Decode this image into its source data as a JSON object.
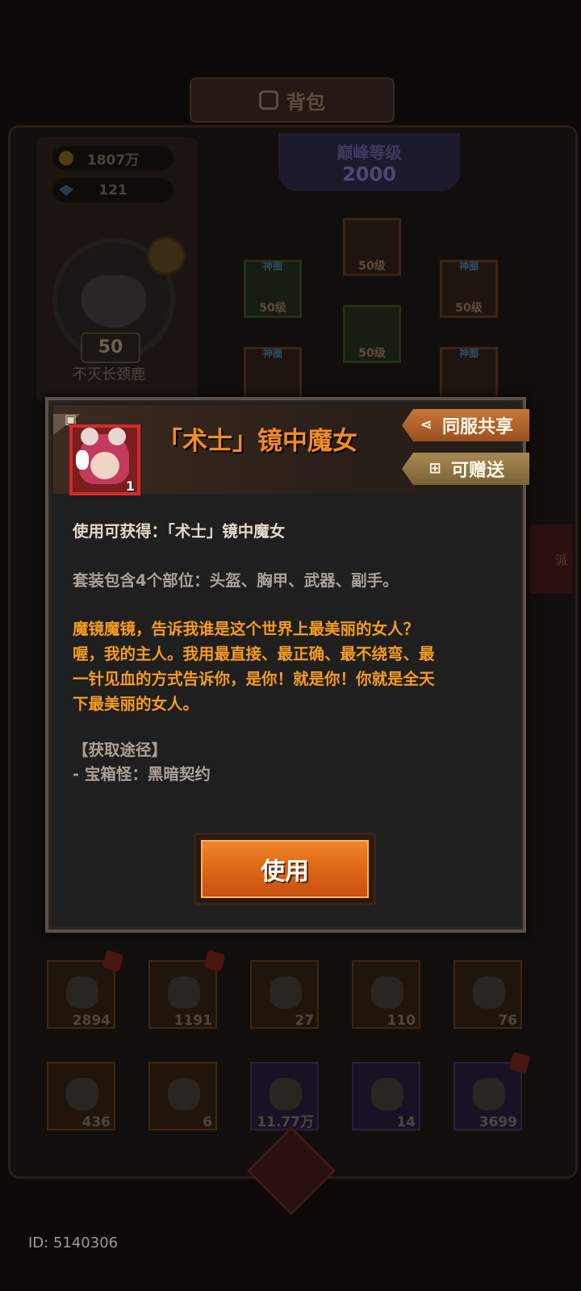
{
  "background": {
    "title": "背包",
    "gold": "1807万",
    "gems": "121",
    "avatar_level": "50",
    "avatar_name": "不灭长颈鹿",
    "peak_title": "巅峰等级",
    "peak_value": "2000",
    "equipment": [
      {
        "tag": "",
        "level": "50级"
      },
      {
        "tag": "神圈",
        "level": "50级"
      },
      {
        "tag": "神圈",
        "level": "50级"
      },
      {
        "tag": "",
        "level": "50级"
      },
      {
        "tag": "神圈",
        "level": ""
      },
      {
        "tag": "神圈",
        "level": ""
      }
    ],
    "side_tab": "派",
    "inventory": [
      {
        "count": "2894",
        "alert": true
      },
      {
        "count": "1191",
        "alert": true
      },
      {
        "count": "27",
        "alert": false
      },
      {
        "count": "110",
        "alert": false
      },
      {
        "count": "76",
        "alert": false
      },
      {
        "count": "436",
        "alert": false
      },
      {
        "count": "6",
        "alert": false
      },
      {
        "count": "11.77万",
        "alert": false
      },
      {
        "count": "14",
        "alert": false
      },
      {
        "count": "3699",
        "alert": true
      }
    ]
  },
  "modal": {
    "item_title": "「术士」镜中魔女",
    "item_count": "1",
    "share_label": "同服共享",
    "gift_label": "可赠送",
    "obtain_line": "使用可获得：「术士」镜中魔女",
    "set_line": "套装包含4个部位：头盔、胸甲、武器、副手。",
    "flavor_line1": "魔镜魔镜，告诉我谁是这个世界上最美丽的女人？",
    "flavor_line2": "喔，我的主人。我用最直接、最正确、最不绕弯、最",
    "flavor_line3": "一针见血的方式告诉你，是你！就是你！你就是全天",
    "flavor_line4": "下最美丽的女人。",
    "source_header": "【获取途径】",
    "source_item": "- 宝箱怪：黑暗契约",
    "use_button": "使用"
  },
  "footer": {
    "user_id": "ID: 5140306"
  },
  "colors": {
    "title_orange": "#f28a2a",
    "flavor_orange": "#f59b22",
    "use_button": "#e06a18",
    "item_frame_red": "#d22b2b"
  }
}
